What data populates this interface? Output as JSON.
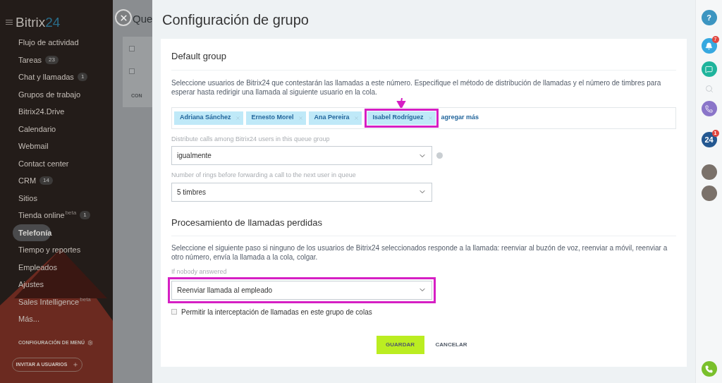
{
  "sidebar": {
    "logo": {
      "text": "Bitrix",
      "accent": "24"
    },
    "items": [
      {
        "label": "Flujo de actividad",
        "selected": false
      },
      {
        "label": "Tareas",
        "count": "23",
        "selected": false
      },
      {
        "label": "Chat y llamadas",
        "count": "1",
        "selected": false
      },
      {
        "label": "Grupos de trabajo",
        "selected": false
      },
      {
        "label": "Bitrix24.Drive",
        "selected": false
      },
      {
        "label": "Calendario",
        "selected": false
      },
      {
        "label": "Webmail",
        "selected": false
      },
      {
        "label": "Contact center",
        "selected": false
      },
      {
        "label": "CRM",
        "count": "14",
        "selected": false
      },
      {
        "label": "Sitios",
        "selected": false
      },
      {
        "label": "Tienda online",
        "sup": "beta",
        "count": "1",
        "selected": false
      },
      {
        "label": "Telefonía",
        "selected": true
      },
      {
        "label": "Tiempo y reportes",
        "selected": false
      },
      {
        "label": "Empleados",
        "selected": false
      },
      {
        "label": "Ajustes",
        "selected": false
      },
      {
        "label": "Sales Intelligence",
        "sup": "beta",
        "selected": false
      },
      {
        "label": "Más...",
        "selected": false
      }
    ],
    "config": "CONFIGURACIÓN DE MENÚ",
    "invite": "INVITAR A USUARIOS"
  },
  "background_page": {
    "title": "Que",
    "rows": [
      {
        "checked": false
      },
      {
        "checked": false
      }
    ],
    "footer": "CON"
  },
  "panel": {
    "title": "Configuración de grupo",
    "section_1": {
      "title": "Default group",
      "description": "Seleccione usuarios de Bitrix24 que contestarán las llamadas a este número. Especifique el método de distribución de llamadas y el número de timbres para esperar hasta redirigir una llamada al siguiente usuario en la cola.",
      "users": [
        {
          "name": "Adriana Sánchez",
          "highlighted": false
        },
        {
          "name": "Ernesto Morel",
          "highlighted": false
        },
        {
          "name": "Ana Pereira",
          "highlighted": false
        },
        {
          "name": "Isabel Rodríguez",
          "highlighted": true
        }
      ],
      "add_link": "agregar más",
      "fields": [
        {
          "label": "Distribute calls among Bitrix24 users in this queue group",
          "value": "igualmente",
          "help": true
        },
        {
          "label": "Number of rings before forwarding a call to the next user in queue",
          "value": "5 timbres",
          "help": false
        }
      ]
    },
    "section_2": {
      "title": "Procesamiento de llamadas perdidas",
      "description": "Seleccione el siguiente paso si ninguno de los usuarios de Bitrix24 seleccionados responde a la llamada: reenviar al buzón de voz, reenviar a móvil, reenviar a otro número, envía la llamada a la cola, colgar.",
      "field": {
        "label": "If nobody answered",
        "value": "Reenviar llamada al empleado",
        "highlighted": true
      },
      "checkbox": {
        "label": "Permitir la interceptación de llamadas en este grupo de colas",
        "checked": false
      }
    },
    "buttons": {
      "save": "GUARDAR",
      "cancel": "CANCELAR"
    }
  },
  "right_bar": [
    {
      "kind": "help",
      "badge": "?"
    },
    {
      "kind": "bell",
      "count": "7"
    },
    {
      "kind": "chat"
    },
    {
      "kind": "search"
    },
    {
      "kind": "phone"
    },
    {
      "kind": "logo",
      "text": "24",
      "count": "1"
    },
    {
      "kind": "avatar"
    },
    {
      "kind": "avatar"
    },
    {
      "kind": "call"
    }
  ]
}
